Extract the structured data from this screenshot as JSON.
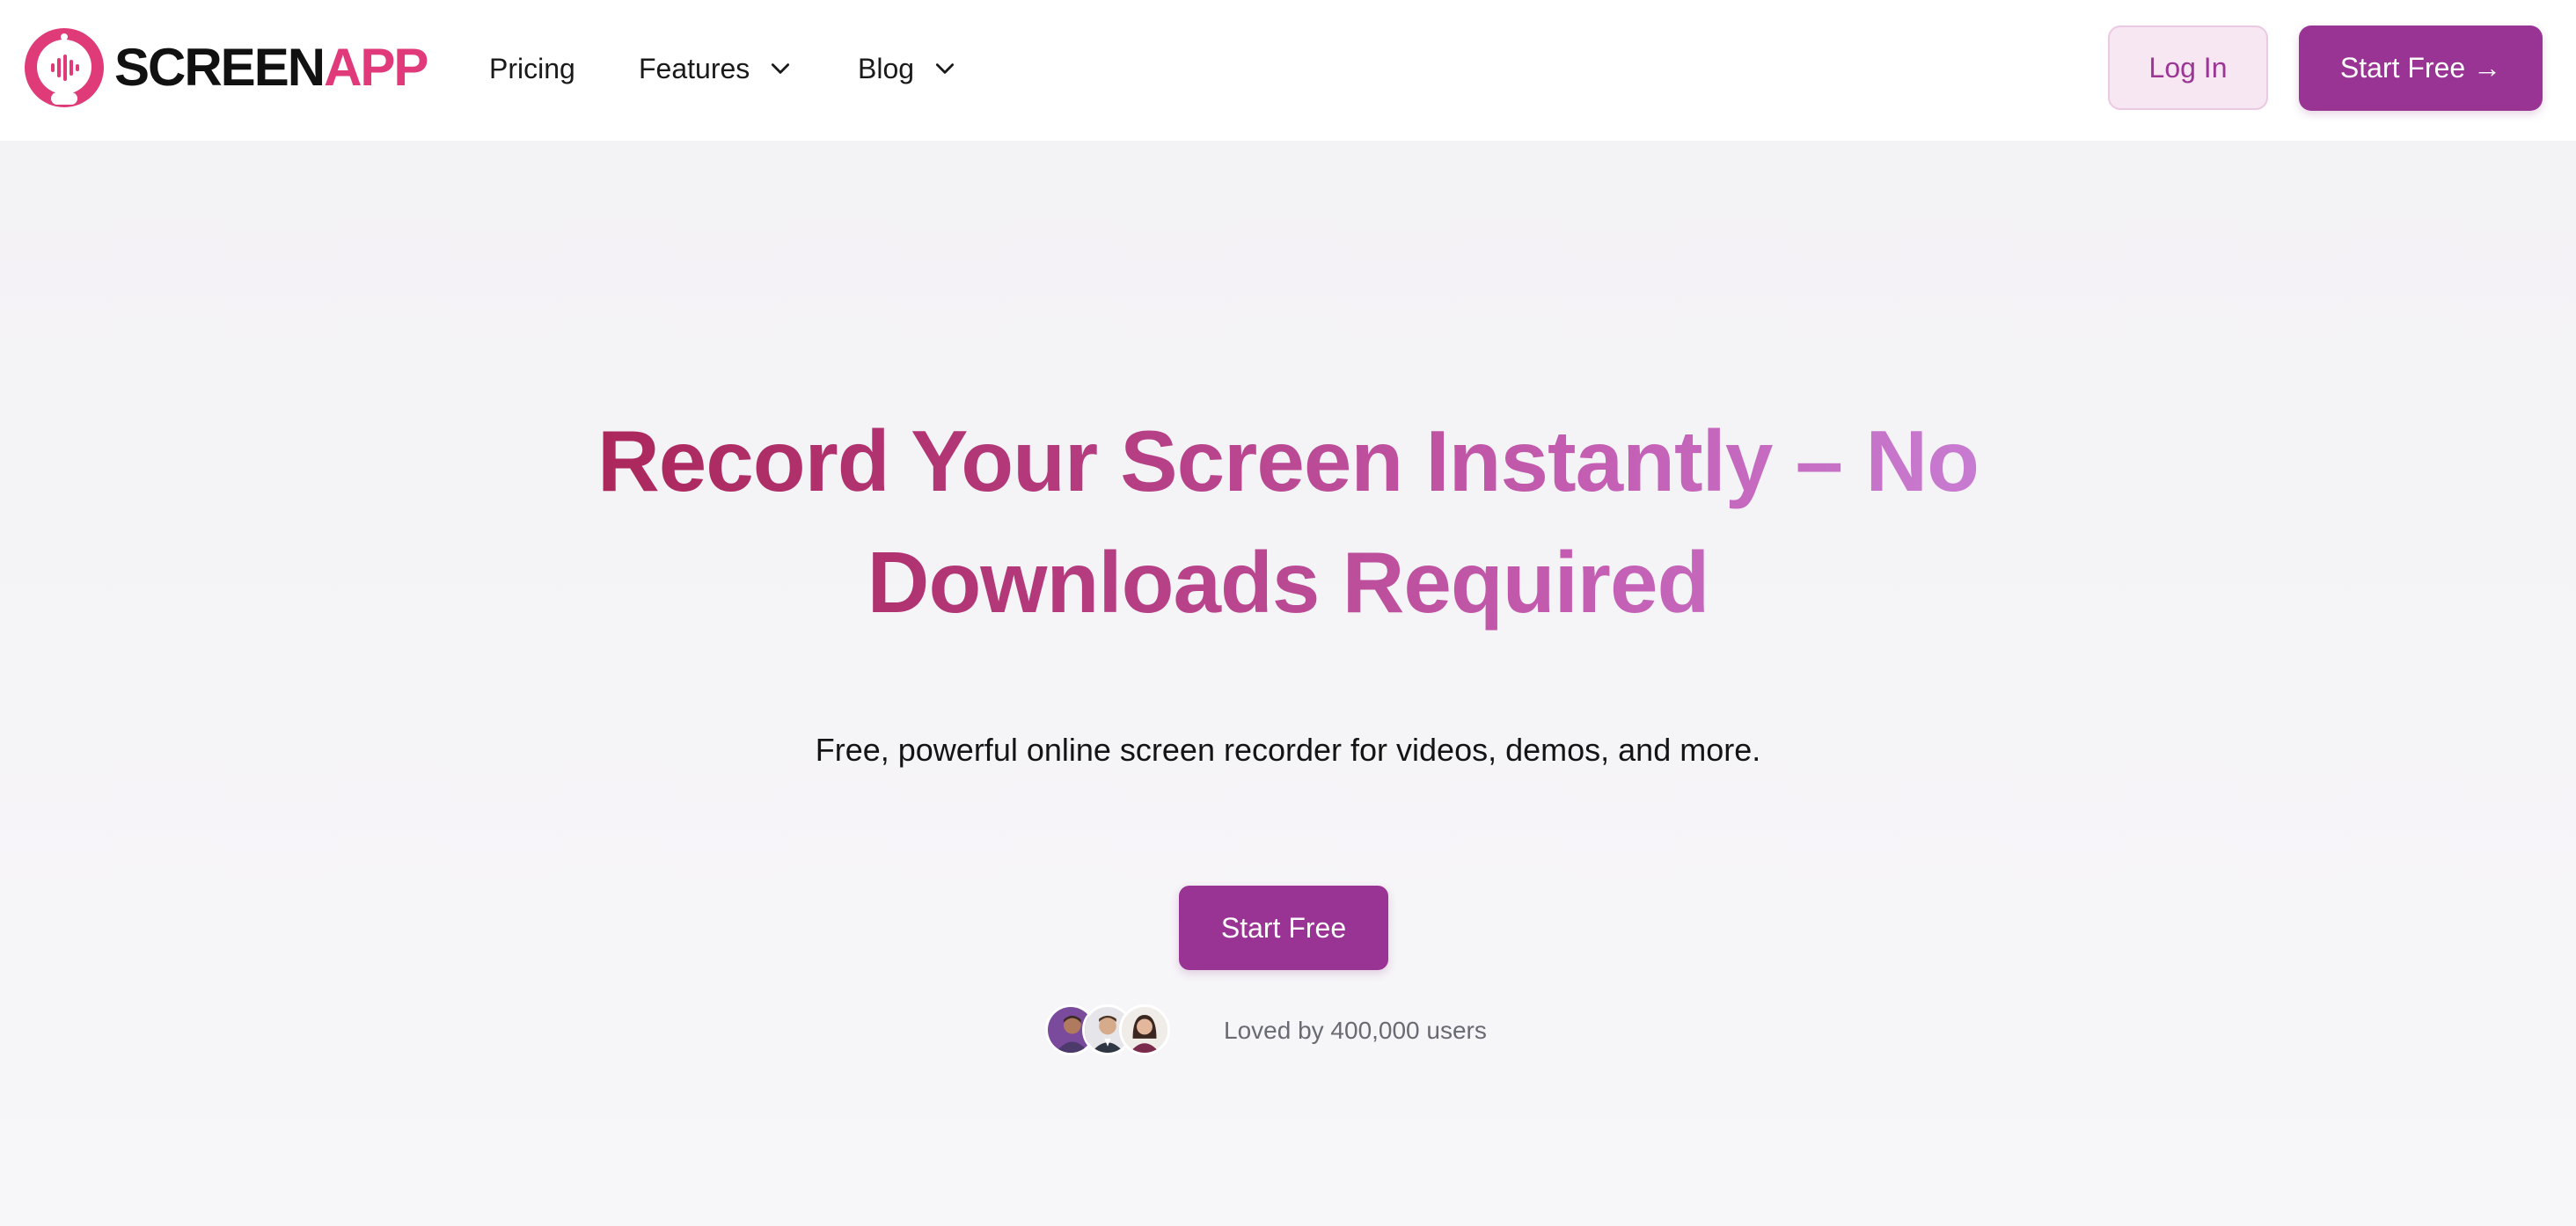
{
  "brand": {
    "name_part1": "SCREEN",
    "name_part2": "APP",
    "colors": {
      "primary": "#993394",
      "logo_accent": "#e03a7a",
      "login_bg": "#f6e7f2"
    }
  },
  "nav": {
    "items": [
      {
        "label": "Pricing",
        "has_dropdown": false
      },
      {
        "label": "Features",
        "has_dropdown": true,
        "icon": "chevron-down-icon"
      },
      {
        "label": "Blog",
        "has_dropdown": true,
        "icon": "chevron-down-icon"
      }
    ]
  },
  "header_actions": {
    "login_label": "Log In",
    "start_label": "Start Free →"
  },
  "hero": {
    "title": "Record Your Screen Instantly – No Downloads Required",
    "subtitle": "Free, powerful online screen recorder for videos, demos, and more.",
    "cta_label": "Start Free",
    "social_proof": "Loved by 400,000 users"
  }
}
